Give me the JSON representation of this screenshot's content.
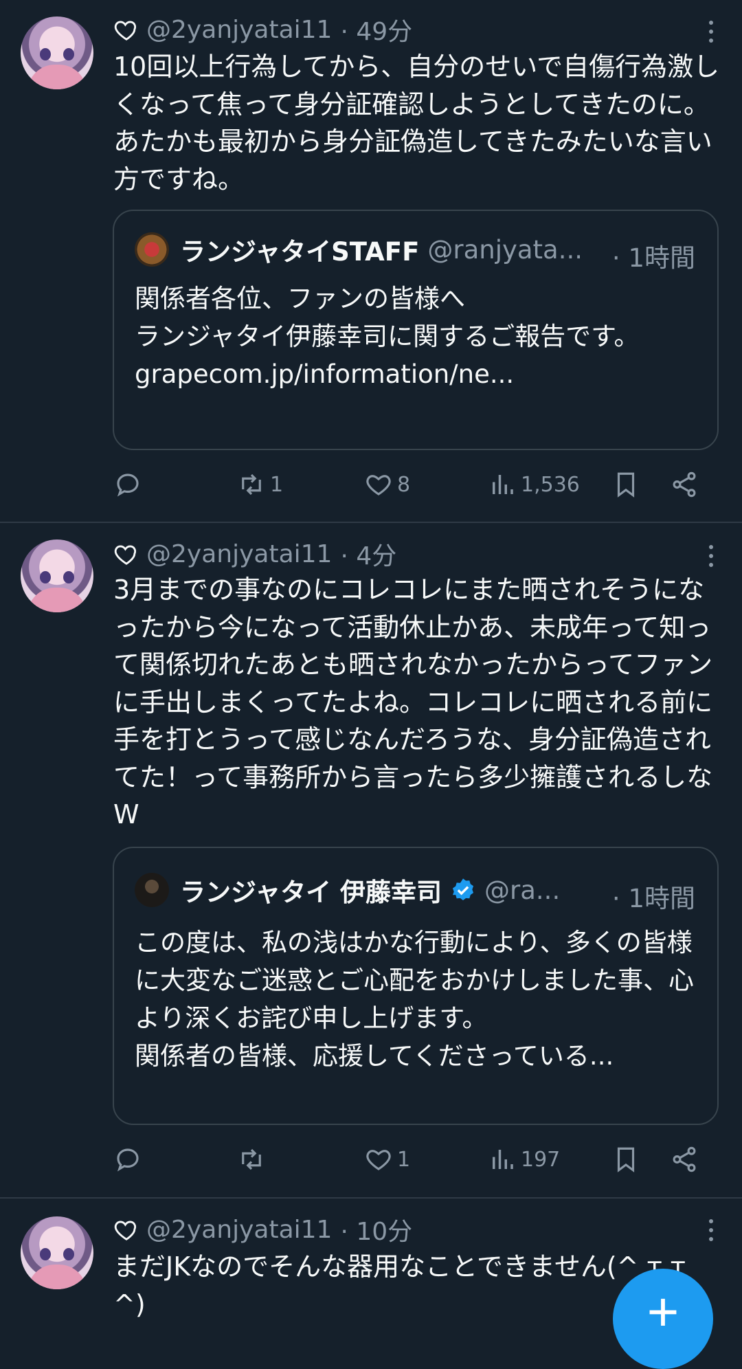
{
  "tweets": [
    {
      "handle": "@2yanjyatai11",
      "time": "· 49分",
      "text": "10回以上行為してから、自分のせいで自傷行為激しくなって焦って身分証確認しようとしてきたのに。あたかも最初から身分証偽造してきたみたいな言い方ですね。",
      "quote": {
        "name": "ランジャタイSTAFF",
        "handle": "@ranjyata...",
        "time": "· 1時間",
        "text": "関係者各位、ファンの皆様へ\nランジャタイ伊藤幸司に関するご報告です。\ngrapecom.jp/information/ne...",
        "verified": false
      },
      "stats": {
        "replies": "",
        "retweets": "1",
        "likes": "8",
        "views": "1,536"
      }
    },
    {
      "handle": "@2yanjyatai11",
      "time": "· 4分",
      "text": "3月までの事なのにコレコレにまた晒されそうになったから今になって活動休止かあ、未成年って知って関係切れたあとも晒されなかったからってファンに手出しまくってたよね。コレコレに晒される前に手を打とうって感じなんだろうな、身分証偽造されてた！って事務所から言ったら多少擁護されるしなW",
      "quote": {
        "name": "ランジャタイ 伊藤幸司",
        "handle": "@ra...",
        "time": "· 1時間",
        "text": "この度は、私の浅はかな行動により、多くの皆様に大変なご迷惑とご心配をおかけしました事、心より深くお詫び申し上げます。\n関係者の皆様、応援してくださっている...",
        "verified": true
      },
      "stats": {
        "replies": "",
        "retweets": "",
        "likes": "1",
        "views": "197"
      }
    },
    {
      "handle": "@2yanjyatai11",
      "time": "· 10分",
      "text": "まだJKなのでそんな器用なことできません(^ ᴛ ᴛ ^)"
    }
  ],
  "fab": {
    "label": "+"
  },
  "colors": {
    "background": "#15202b",
    "accent": "#1d9bf0",
    "muted": "#8b98a5"
  }
}
